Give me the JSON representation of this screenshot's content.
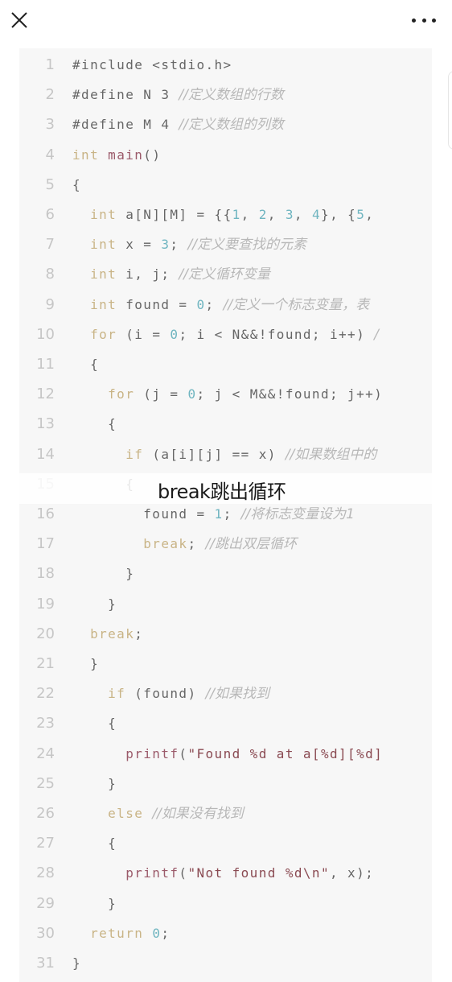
{
  "topbar": {
    "close_icon": "close-icon",
    "more_icon": "more-horizontal-icon"
  },
  "caption": "break跳出循环",
  "colors": {
    "background": "#ffffff",
    "code_background": "#f7f7f7",
    "line_number": "#c6c6c6",
    "keyword": "#c9b486",
    "function": "#9b5a6a",
    "number": "#6fb5c0",
    "string": "#8a4a52",
    "comment": "#b8b8b8"
  },
  "code_lines": [
    {
      "n": "1",
      "tokens": [
        [
          "plain",
          "#include <stdio.h>"
        ]
      ]
    },
    {
      "n": "2",
      "tokens": [
        [
          "plain",
          "#define N 3 "
        ],
        [
          "cm",
          "//定义数组的行数"
        ]
      ]
    },
    {
      "n": "3",
      "tokens": [
        [
          "plain",
          "#define M 4 "
        ],
        [
          "cm",
          "//定义数组的列数"
        ]
      ]
    },
    {
      "n": "4",
      "tokens": [
        [
          "kw",
          "int"
        ],
        [
          "plain",
          " "
        ],
        [
          "fn",
          "main"
        ],
        [
          "plain",
          "()"
        ]
      ]
    },
    {
      "n": "5",
      "tokens": [
        [
          "plain",
          "{"
        ]
      ]
    },
    {
      "n": "6",
      "tokens": [
        [
          "plain",
          "  "
        ],
        [
          "kw",
          "int"
        ],
        [
          "plain",
          " a[N][M] = {{"
        ],
        [
          "num",
          "1"
        ],
        [
          "plain",
          ", "
        ],
        [
          "num",
          "2"
        ],
        [
          "plain",
          ", "
        ],
        [
          "num",
          "3"
        ],
        [
          "plain",
          ", "
        ],
        [
          "num",
          "4"
        ],
        [
          "plain",
          "}, {"
        ],
        [
          "num",
          "5"
        ],
        [
          "plain",
          ","
        ]
      ]
    },
    {
      "n": "7",
      "tokens": [
        [
          "plain",
          "  "
        ],
        [
          "kw",
          "int"
        ],
        [
          "plain",
          " x = "
        ],
        [
          "num",
          "3"
        ],
        [
          "plain",
          "; "
        ],
        [
          "cm",
          "//定义要查找的元素"
        ]
      ]
    },
    {
      "n": "8",
      "tokens": [
        [
          "plain",
          "  "
        ],
        [
          "kw",
          "int"
        ],
        [
          "plain",
          " i, j; "
        ],
        [
          "cm",
          "//定义循环变量"
        ]
      ]
    },
    {
      "n": "9",
      "tokens": [
        [
          "plain",
          "  "
        ],
        [
          "kw",
          "int"
        ],
        [
          "plain",
          " found = "
        ],
        [
          "num",
          "0"
        ],
        [
          "plain",
          "; "
        ],
        [
          "cm",
          "//定义一个标志变量，表"
        ]
      ]
    },
    {
      "n": "10",
      "tokens": [
        [
          "plain",
          "  "
        ],
        [
          "kw",
          "for"
        ],
        [
          "plain",
          " (i = "
        ],
        [
          "num",
          "0"
        ],
        [
          "plain",
          "; i < N&&!found; i++) "
        ],
        [
          "cm",
          "/"
        ]
      ]
    },
    {
      "n": "11",
      "tokens": [
        [
          "plain",
          "  {"
        ]
      ]
    },
    {
      "n": "12",
      "tokens": [
        [
          "plain",
          "    "
        ],
        [
          "kw",
          "for"
        ],
        [
          "plain",
          " (j = "
        ],
        [
          "num",
          "0"
        ],
        [
          "plain",
          "; j < M&&!found; j++)"
        ]
      ]
    },
    {
      "n": "13",
      "tokens": [
        [
          "plain",
          "    {"
        ]
      ]
    },
    {
      "n": "14",
      "tokens": [
        [
          "plain",
          "      "
        ],
        [
          "kw",
          "if"
        ],
        [
          "plain",
          " (a[i][j] == x) "
        ],
        [
          "cm",
          "//如果数组中的"
        ]
      ]
    },
    {
      "n": "15",
      "tokens": [
        [
          "plain",
          "      {"
        ]
      ]
    },
    {
      "n": "16",
      "tokens": [
        [
          "plain",
          "        found = "
        ],
        [
          "num",
          "1"
        ],
        [
          "plain",
          "; "
        ],
        [
          "cm",
          "//将标志变量设为1"
        ]
      ]
    },
    {
      "n": "17",
      "tokens": [
        [
          "plain",
          "        "
        ],
        [
          "kw",
          "break"
        ],
        [
          "plain",
          "; "
        ],
        [
          "cm",
          "//跳出双层循环"
        ]
      ]
    },
    {
      "n": "18",
      "tokens": [
        [
          "plain",
          "      }"
        ]
      ]
    },
    {
      "n": "19",
      "tokens": [
        [
          "plain",
          "    }"
        ]
      ]
    },
    {
      "n": "20",
      "tokens": [
        [
          "plain",
          "  "
        ],
        [
          "kw",
          "break"
        ],
        [
          "plain",
          ";"
        ]
      ]
    },
    {
      "n": "21",
      "tokens": [
        [
          "plain",
          "  }"
        ]
      ]
    },
    {
      "n": "22",
      "tokens": [
        [
          "plain",
          "    "
        ],
        [
          "kw",
          "if"
        ],
        [
          "plain",
          " (found) "
        ],
        [
          "cm",
          "//如果找到"
        ]
      ]
    },
    {
      "n": "23",
      "tokens": [
        [
          "plain",
          "    {"
        ]
      ]
    },
    {
      "n": "24",
      "tokens": [
        [
          "plain",
          "      "
        ],
        [
          "fn",
          "printf"
        ],
        [
          "plain",
          "("
        ],
        [
          "str",
          "\"Found %d at a[%d][%d]"
        ]
      ]
    },
    {
      "n": "25",
      "tokens": [
        [
          "plain",
          "    }"
        ]
      ]
    },
    {
      "n": "26",
      "tokens": [
        [
          "plain",
          "    "
        ],
        [
          "kw",
          "else"
        ],
        [
          "plain",
          " "
        ],
        [
          "cm",
          "//如果没有找到"
        ]
      ]
    },
    {
      "n": "27",
      "tokens": [
        [
          "plain",
          "    {"
        ]
      ]
    },
    {
      "n": "28",
      "tokens": [
        [
          "plain",
          "      "
        ],
        [
          "fn",
          "printf"
        ],
        [
          "plain",
          "("
        ],
        [
          "str",
          "\"Not found %d\\n\""
        ],
        [
          "plain",
          ", x);"
        ]
      ]
    },
    {
      "n": "29",
      "tokens": [
        [
          "plain",
          "    }"
        ]
      ]
    },
    {
      "n": "30",
      "tokens": [
        [
          "plain",
          "  "
        ],
        [
          "kw",
          "return"
        ],
        [
          "plain",
          " "
        ],
        [
          "num",
          "0"
        ],
        [
          "plain",
          ";"
        ]
      ]
    },
    {
      "n": "31",
      "tokens": [
        [
          "plain",
          "}"
        ]
      ]
    }
  ]
}
